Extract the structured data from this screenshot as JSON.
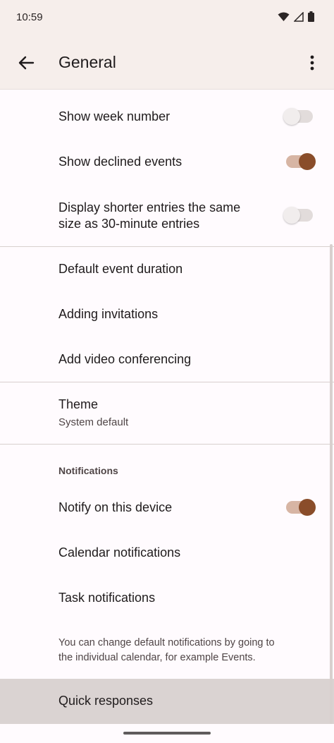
{
  "status_bar": {
    "time": "10:59"
  },
  "app_bar": {
    "title": "General"
  },
  "settings": {
    "show_week_number": {
      "label": "Show week number",
      "enabled": false
    },
    "show_declined_events": {
      "label": "Show declined events",
      "enabled": true
    },
    "shorter_entries": {
      "label_line1": "Display shorter entries the same",
      "label_line2": "size as 30-minute entries",
      "enabled": false
    },
    "default_event_duration": {
      "label": "Default event duration"
    },
    "adding_invitations": {
      "label": "Adding invitations"
    },
    "add_video_conferencing": {
      "label": "Add video conferencing"
    },
    "theme": {
      "label": "Theme",
      "value": "System default"
    },
    "notifications_header": "Notifications",
    "notify_on_device": {
      "label": "Notify on this device",
      "enabled": true
    },
    "calendar_notifications": {
      "label": "Calendar notifications"
    },
    "task_notifications": {
      "label": "Task notifications"
    },
    "footnote_line1": "You can change default notifications by going to",
    "footnote_line2": "the individual calendar, for example Events.",
    "quick_responses": {
      "label": "Quick responses"
    }
  },
  "colors": {
    "accent": "#8a4d2a",
    "accent_track": "#d7b5a4",
    "app_bar_bg": "#f6eeeb",
    "background": "#fffbfe"
  }
}
